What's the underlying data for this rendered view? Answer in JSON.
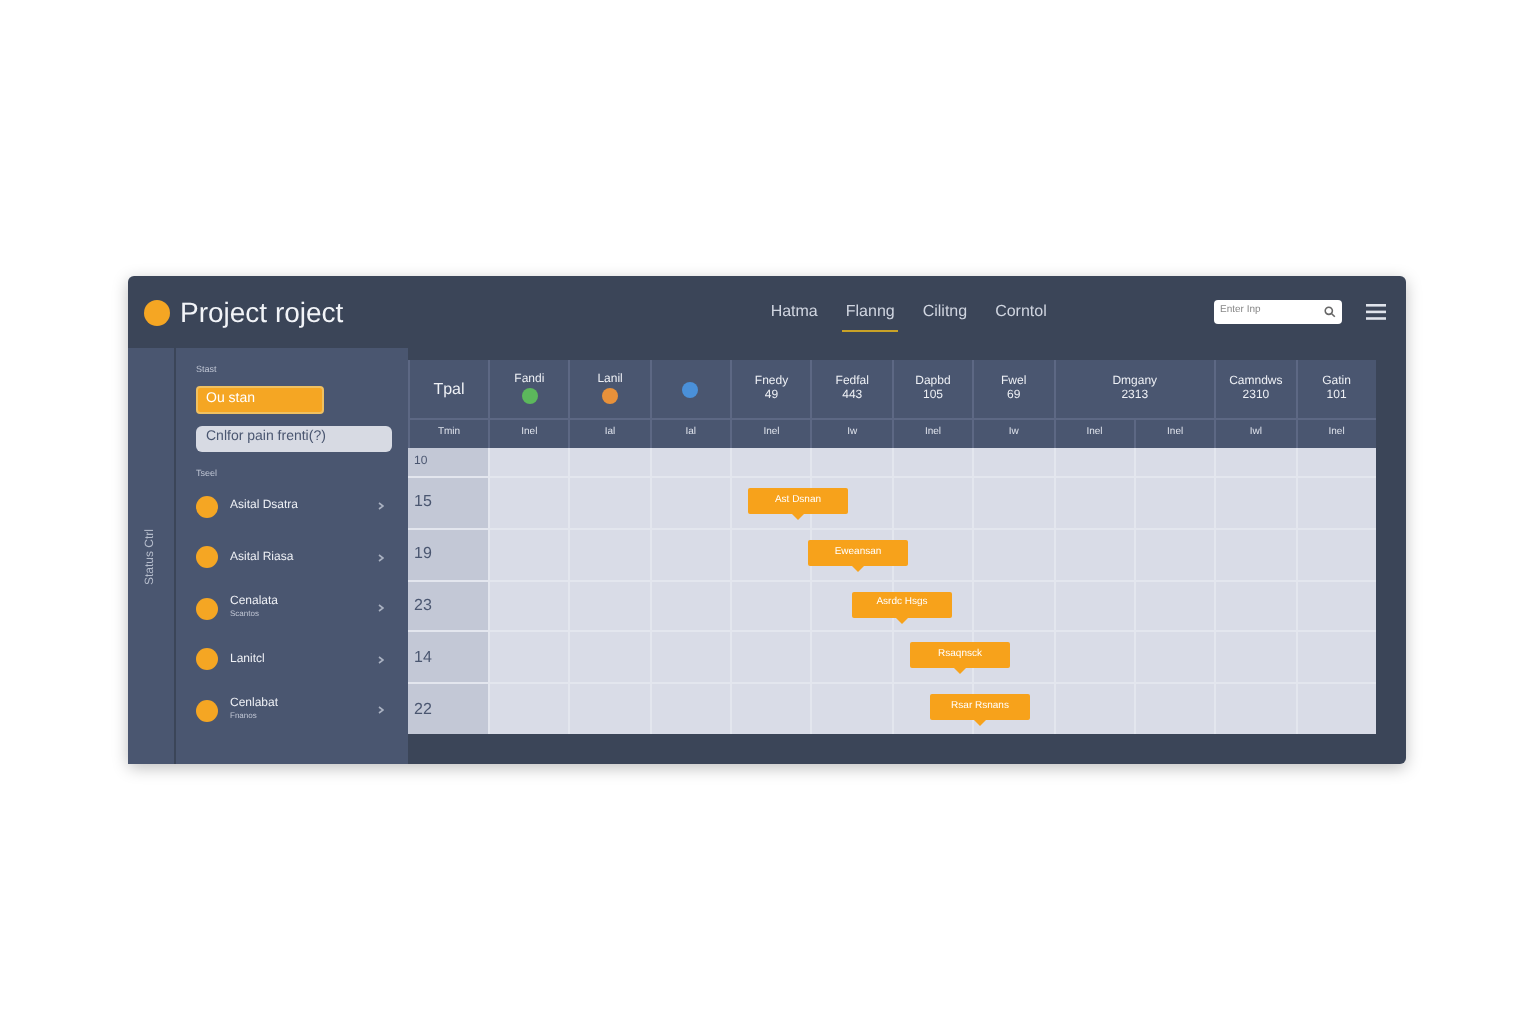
{
  "app": {
    "title": "Project roject"
  },
  "nav": [
    {
      "label": "Hatma",
      "selected": false
    },
    {
      "label": "Flanng",
      "selected": true
    },
    {
      "label": "Cilitng",
      "selected": false
    },
    {
      "label": "Corntol",
      "selected": false
    }
  ],
  "search": {
    "placeholder": "Enter Inp"
  },
  "side_strip": {
    "label": "Status Ctrl"
  },
  "sidebar": {
    "section_1": "Stast",
    "primary_button": "Ou stan",
    "secondary_button": "Cnlfor pain frenti(?)",
    "section_2": "Tseel",
    "items": [
      {
        "name": "Asital Dsatra"
      },
      {
        "name": "Asital Riasa"
      },
      {
        "name": "Cenalata",
        "sub": "Scantos"
      },
      {
        "name": "Lanitcl"
      },
      {
        "name": "Cenlabat",
        "sub": "Fnanos"
      }
    ]
  },
  "grid": {
    "corner": "Tpal",
    "corner_sub": "Tmin",
    "columns": [
      {
        "name": "Fandi",
        "color": "#5cb85c"
      },
      {
        "name": "Lanil",
        "color": "#e8913a"
      },
      {
        "color": "#4a90d9"
      },
      {
        "name": "Fnedy",
        "value": "49"
      },
      {
        "name": "Fedfal",
        "value": "443"
      },
      {
        "name": "Dapbd",
        "value": "105"
      },
      {
        "name": "Fwel",
        "value": "69"
      },
      {
        "name": "Dmgany",
        "value": "2313"
      },
      {
        "name": "Camndws",
        "value": "2310"
      },
      {
        "name": "Gatin",
        "value": "101"
      }
    ],
    "subheads": [
      "Inel",
      "Ial",
      "Ial",
      "Inel",
      "Iw",
      "Inel",
      "Iw",
      "Inel",
      "Inel",
      "Iwl",
      "Inel"
    ],
    "top_row": "10",
    "rows": [
      {
        "label": "15",
        "event": "Ast Dsnan"
      },
      {
        "label": "19",
        "event": "Eweansan"
      },
      {
        "label": "23",
        "event": "Asrdc Hsgs"
      },
      {
        "label": "14",
        "event": "Rsaqnsck"
      },
      {
        "label": "22",
        "event": "Rsar Rsnans"
      }
    ]
  }
}
